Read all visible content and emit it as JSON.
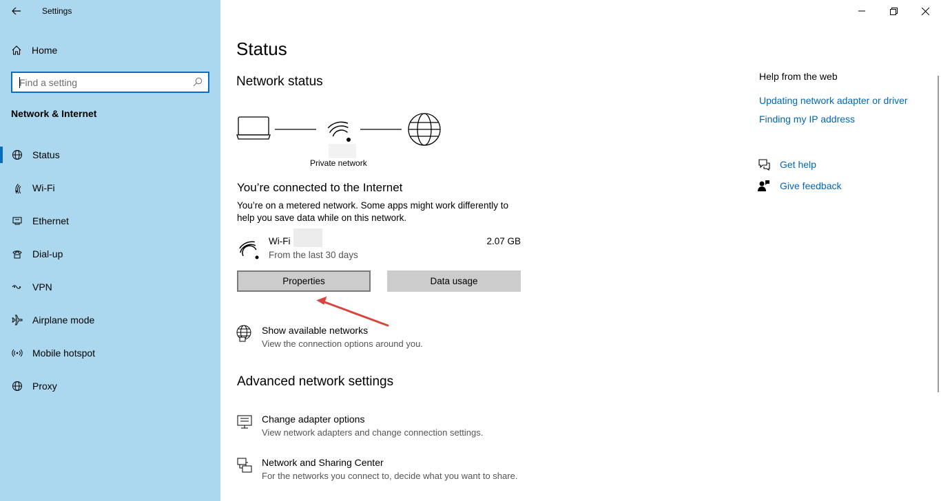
{
  "window": {
    "title": "Settings",
    "controls": {
      "minimize": "minimize-icon",
      "restore": "restore-icon",
      "close": "close-icon"
    }
  },
  "sidebar": {
    "home_label": "Home",
    "search_placeholder": "Find a setting",
    "section_title": "Network & Internet",
    "items": [
      {
        "label": "Status",
        "icon": "globe-icon",
        "active": true
      },
      {
        "label": "Wi-Fi",
        "icon": "wifi-icon"
      },
      {
        "label": "Ethernet",
        "icon": "ethernet-icon"
      },
      {
        "label": "Dial-up",
        "icon": "dialup-icon"
      },
      {
        "label": "VPN",
        "icon": "vpn-icon"
      },
      {
        "label": "Airplane mode",
        "icon": "airplane-icon"
      },
      {
        "label": "Mobile hotspot",
        "icon": "hotspot-icon"
      },
      {
        "label": "Proxy",
        "icon": "proxy-globe-icon"
      }
    ]
  },
  "main": {
    "title": "Status",
    "network_status_heading": "Network status",
    "network_type_label": "Private network",
    "connected_heading": "You’re connected to the Internet",
    "metered_text": "You’re on a metered network. Some apps might work differently to help you save data while on this network.",
    "connection": {
      "name": "Wi-Fi",
      "subtitle": "From the last 30 days",
      "usage": "2.07 GB"
    },
    "buttons": {
      "properties": "Properties",
      "data_usage": "Data usage"
    },
    "show_networks": {
      "title": "Show available networks",
      "subtitle": "View the connection options around you."
    },
    "advanced_heading": "Advanced network settings",
    "advanced_items": [
      {
        "title": "Change adapter options",
        "subtitle": "View network adapters and change connection settings."
      },
      {
        "title": "Network and Sharing Center",
        "subtitle": "For the networks you connect to, decide what you want to share."
      }
    ]
  },
  "help": {
    "title": "Help from the web",
    "links": [
      "Updating network adapter or driver",
      "Finding my IP address"
    ],
    "get_help": "Get help",
    "give_feedback": "Give feedback"
  },
  "colors": {
    "sidebar_bg": "#abd8ee",
    "accent": "#0a6cbf",
    "link": "#0067b8",
    "annotation_arrow": "#d9453f"
  }
}
